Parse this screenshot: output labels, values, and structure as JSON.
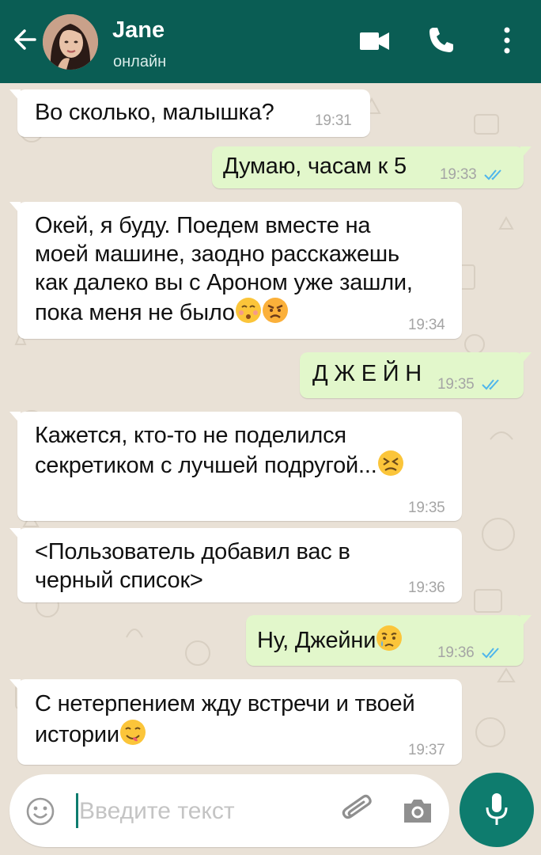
{
  "header": {
    "back_icon": "arrow-left-icon",
    "contact_name": "Jane",
    "contact_status": "онлайн",
    "video_icon": "video-camera-icon",
    "call_icon": "phone-icon",
    "menu_icon": "kebab-menu-icon"
  },
  "messages": [
    {
      "dir": "in",
      "lines": [
        "Во сколько, малышка?"
      ],
      "time": "19:31"
    },
    {
      "dir": "out",
      "lines": [
        "Думаю, часам к 5"
      ],
      "time": "19:33",
      "read": true
    },
    {
      "dir": "in",
      "lines": [
        "Окей, я буду. Поедем вместе на",
        "моей машине, заодно расскажешь",
        "как далеко вы с Ароном уже зашли,",
        "пока меня не было"
      ],
      "emojis": [
        "kissing-face-icon",
        "angry-face-icon"
      ],
      "time": "19:34"
    },
    {
      "dir": "out",
      "lines": [
        "Д Ж Е Й Н"
      ],
      "time": "19:35",
      "read": true
    },
    {
      "dir": "in",
      "lines": [
        "Кажется, кто-то не поделился",
        "секретиком с лучшей подругой..."
      ],
      "emojis": [
        "persevering-face-icon"
      ],
      "time": "19:35"
    },
    {
      "dir": "in",
      "lines": [
        "<Пользователь добавил вас в",
        "черный список>"
      ],
      "time": "19:36"
    },
    {
      "dir": "out",
      "lines": [
        "Ну, Джейни"
      ],
      "emojis": [
        "crying-face-icon"
      ],
      "time": "19:36",
      "read": true
    },
    {
      "dir": "in",
      "lines": [
        "С нетерпением жду встречи и твоей",
        "истории"
      ],
      "emojis": [
        "yum-face-icon"
      ],
      "time": "19:37"
    }
  ],
  "input": {
    "placeholder": "Введите текст",
    "emoji_icon": "smiley-icon",
    "attach_icon": "paperclip-icon",
    "camera_icon": "camera-icon",
    "mic_icon": "microphone-icon"
  },
  "colors": {
    "header": "#0a5d54",
    "outgoing_bubble": "#e2f7cb",
    "incoming_bubble": "#ffffff",
    "read_ticks": "#4fb6ec",
    "mic_button": "#0e7c6e"
  }
}
